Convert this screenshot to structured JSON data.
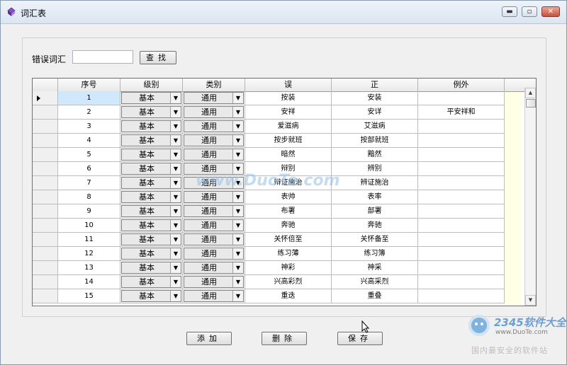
{
  "window": {
    "title": "词汇表",
    "controls": [
      "▬",
      "▫",
      "✕"
    ]
  },
  "search": {
    "label": "错误词汇",
    "value": "",
    "button": "查找"
  },
  "grid": {
    "columns": [
      "序号",
      "级别",
      "类别",
      "误",
      "正",
      "例外"
    ],
    "rows": [
      {
        "id": "1",
        "level": "基本",
        "category": "通用",
        "wrong": "按装",
        "right": "安装",
        "exception": ""
      },
      {
        "id": "2",
        "level": "基本",
        "category": "通用",
        "wrong": "安祥",
        "right": "安详",
        "exception": "平安祥和"
      },
      {
        "id": "3",
        "level": "基本",
        "category": "通用",
        "wrong": "爱滋病",
        "right": "艾滋病",
        "exception": ""
      },
      {
        "id": "4",
        "level": "基本",
        "category": "通用",
        "wrong": "按步就班",
        "right": "按部就班",
        "exception": ""
      },
      {
        "id": "5",
        "level": "基本",
        "category": "通用",
        "wrong": "暗然",
        "right": "黯然",
        "exception": ""
      },
      {
        "id": "6",
        "level": "基本",
        "category": "通用",
        "wrong": "辩别",
        "right": "辨别",
        "exception": ""
      },
      {
        "id": "7",
        "level": "基本",
        "category": "通用",
        "wrong": "辩证施治",
        "right": "辨证施治",
        "exception": ""
      },
      {
        "id": "8",
        "level": "基本",
        "category": "通用",
        "wrong": "表帅",
        "right": "表率",
        "exception": ""
      },
      {
        "id": "9",
        "level": "基本",
        "category": "通用",
        "wrong": "布署",
        "right": "部署",
        "exception": ""
      },
      {
        "id": "10",
        "level": "基本",
        "category": "通用",
        "wrong": "奔驰",
        "right": "奔驰",
        "exception": ""
      },
      {
        "id": "11",
        "level": "基本",
        "category": "通用",
        "wrong": "关怀倍至",
        "right": "关怀备至",
        "exception": ""
      },
      {
        "id": "12",
        "level": "基本",
        "category": "通用",
        "wrong": "练习薄",
        "right": "练习簿",
        "exception": ""
      },
      {
        "id": "13",
        "level": "基本",
        "category": "通用",
        "wrong": "神彩",
        "right": "神采",
        "exception": ""
      },
      {
        "id": "14",
        "level": "基本",
        "category": "通用",
        "wrong": "兴高彩烈",
        "right": "兴高采烈",
        "exception": ""
      },
      {
        "id": "15",
        "level": "基本",
        "category": "通用",
        "wrong": "重迭",
        "right": "重叠",
        "exception": ""
      }
    ]
  },
  "actions": {
    "add": "添加",
    "delete": "删除",
    "save": "保存"
  },
  "watermark": "www.DuoTe.com",
  "corner_logo": {
    "brand": "2345软件大全",
    "url": "www.DuoTe.com",
    "tagline": "国内最安全的软件站"
  },
  "colors": {
    "window_bg": "#f0f0f0",
    "current_cell": "#cfe8fb",
    "exception_bg": "#ffffe6",
    "close_button": "#c8503b"
  }
}
